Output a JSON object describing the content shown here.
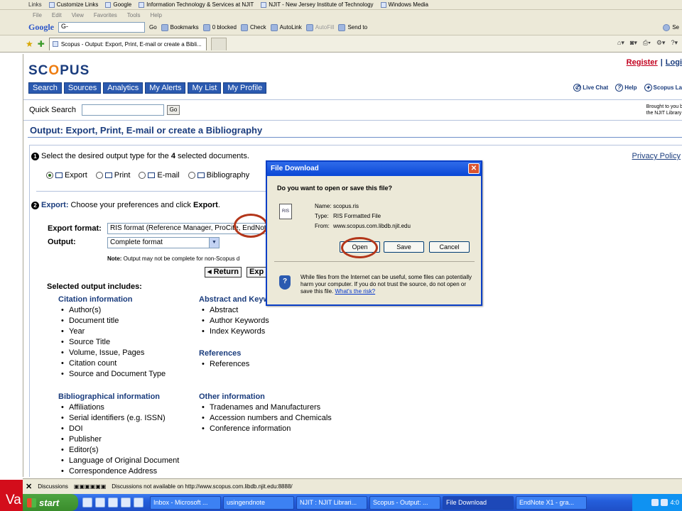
{
  "browser": {
    "links_label": "Links",
    "links": [
      "Customize Links",
      "Google",
      "Information Technology & Services at NJIT",
      "NJIT - New Jersey Institute of Technology",
      "Windows Media"
    ],
    "menu": [
      "File",
      "Edit",
      "View",
      "Favorites",
      "Tools",
      "Help"
    ],
    "google_logo": "Google",
    "google_search_value": "G-",
    "toolbar_items": [
      "Go",
      "Bookmarks",
      "0 blocked",
      "Check",
      "AutoLink",
      "AutoFill",
      "Send to"
    ],
    "settings_label": "Se",
    "tab_title": "Scopus - Output: Export, Print, E-mail or create a Bibli...",
    "right_tools": [
      "▾",
      "▾",
      "▾",
      "▾",
      "▾"
    ]
  },
  "page": {
    "logo_prefix": "SC",
    "logo_o": "O",
    "logo_suffix": "PUS",
    "register": "Register",
    "login": "Logi",
    "nav": [
      "Search",
      "Sources",
      "Analytics",
      "My Alerts",
      "My List",
      "My Profile"
    ],
    "help_links": [
      "Live Chat",
      "Help",
      "Scopus La"
    ],
    "quick_search_label": "Quick Search",
    "quick_search_value": "",
    "go_label": "Go",
    "brought_line1": "Brought to you b",
    "brought_line2": "the NJIT Library",
    "heading": "Output: Export, Print, E-mail or create a Bibliography",
    "step1_prefix": "Select the desired output type for the ",
    "step1_count": "4",
    "step1_suffix": " selected documents.",
    "privacy": "Privacy Policy",
    "output_types": [
      "Export",
      "Print",
      "E-mail",
      "Bibliography"
    ],
    "selected_output_type": "Export",
    "step2_label": "Export:",
    "step2_text_before": " Choose your preferences and click ",
    "step2_text_export": "Export",
    "step2_text_after": ".",
    "export_format_label": "Export format:",
    "export_format_value": "RIS format (Reference Manager, ProCite, EndNote",
    "output_label": "Output:",
    "output_value": "Complete format",
    "note_label": "Note:",
    "note_text": " Output may not be complete for non-Scopus d",
    "return_label": "Return",
    "export_btn_partial": "Exp",
    "selected_output_includes": "Selected output includes:",
    "groups": [
      {
        "title": "Citation information",
        "items": [
          "Author(s)",
          "Document title",
          "Year",
          "Source Title",
          "Volume, Issue, Pages",
          "Citation count",
          "Source and Document Type"
        ]
      },
      {
        "title": "Bibliographical information",
        "items": [
          "Affiliations",
          "Serial identifiers (e.g. ISSN)",
          "DOI",
          "Publisher",
          "Editor(s)",
          "Language of Original Document",
          "Correspondence Address"
        ]
      },
      {
        "title": "Abstract and Keyw",
        "items": [
          "Abstract",
          "Author Keywords",
          "Index Keywords"
        ]
      },
      {
        "title": "References",
        "items": [
          "References"
        ]
      },
      {
        "title": "Other information",
        "items": [
          "Tradenames and Manufacturers",
          "Accession numbers and Chemicals",
          "Conference information"
        ]
      }
    ]
  },
  "dialog": {
    "title": "File Download",
    "question": "Do you want to open or save this file?",
    "name_label": "Name:",
    "name_value": "scopus.ris",
    "type_label": "Type:",
    "type_value": "RIS Formatted File",
    "from_label": "From:",
    "from_value": "www.scopus.com.libdb.njit.edu",
    "open": "Open",
    "save": "Save",
    "cancel": "Cancel",
    "warning": "While files from the Internet can be useful, some files can potentially harm your computer. If you do not trust the source, do not open or save this file. ",
    "risk_link": "What's the risk?"
  },
  "status": {
    "discussions": "Discussions",
    "message": "Discussions not available on http://www.scopus.com.libdb.njit.edu:8888/"
  },
  "taskbar": {
    "start": "start",
    "tasks": [
      "Inbox - Microsoft ...",
      "usingendnote",
      "NJIT : NJIT Librari...",
      "Scopus - Output: ...",
      "File Download",
      "EndNote X1 - gra..."
    ],
    "active_task": "File Download",
    "clock": "4:0"
  },
  "corner_text": "Va",
  "colors": {
    "scopus_blue": "#1a3c7d",
    "scopus_orange": "#ee7d11",
    "register_red": "#c2001e",
    "highlight_circle": "#b3361a",
    "xp_title_blue": "#0a47d6"
  }
}
